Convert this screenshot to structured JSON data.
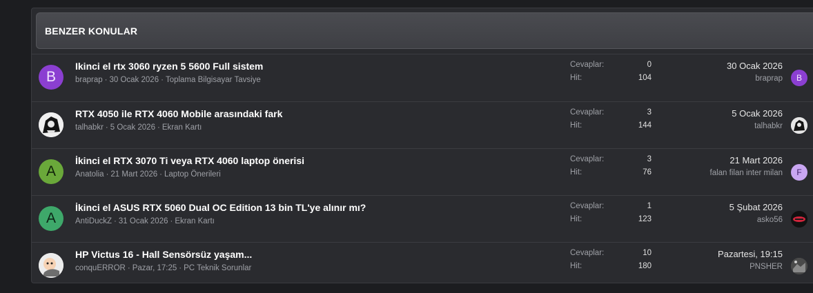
{
  "header": {
    "title": "BENZER KONULAR"
  },
  "labels": {
    "replies": "Cevaplar:",
    "views": "Hit:"
  },
  "threads": [
    {
      "avatar_letter": "B",
      "title": "Ikinci el rtx 3060 ryzen 5 5600 Full sistem",
      "author": "braprap",
      "date": "30 Ocak 2026",
      "forum": "Toplama Bilgisayar Tavsiye",
      "replies": "0",
      "views": "104",
      "last_date": "30 Ocak 2026",
      "last_user": "braprap",
      "last_avatar_letter": "B"
    },
    {
      "avatar_letter": "",
      "title": "RTX 4050 ile RTX 4060 Mobile arasındaki fark",
      "author": "talhabkr",
      "date": "5 Ocak 2026",
      "forum": "Ekran Kartı",
      "replies": "3",
      "views": "144",
      "last_date": "5 Ocak 2026",
      "last_user": "talhabkr",
      "last_avatar_letter": ""
    },
    {
      "avatar_letter": "A",
      "title": "İkinci el RTX 3070 Ti veya RTX 4060 laptop önerisi",
      "author": "Anatolia",
      "date": "21 Mart 2026",
      "forum": "Laptop Önerileri",
      "replies": "3",
      "views": "76",
      "last_date": "21 Mart 2026",
      "last_user": "falan filan inter milan",
      "last_avatar_letter": "F"
    },
    {
      "avatar_letter": "A",
      "title": "İkinci el ASUS RTX 5060 Dual OC Edition 13 bin TL'ye alınır mı?",
      "author": "AntiDuckZ",
      "date": "31 Ocak 2026",
      "forum": "Ekran Kartı",
      "replies": "1",
      "views": "123",
      "last_date": "5 Şubat 2026",
      "last_user": "asko56",
      "last_avatar_letter": ""
    },
    {
      "avatar_letter": "",
      "title": "HP Victus 16 - Hall Sensörsüz yaşam...",
      "author": "conquERROR",
      "date": "Pazar, 17:25",
      "forum": "PC Teknik Sorunlar",
      "replies": "10",
      "views": "180",
      "last_date": "Pazartesi, 19:15",
      "last_user": "PNSHER",
      "last_avatar_letter": ""
    }
  ]
}
